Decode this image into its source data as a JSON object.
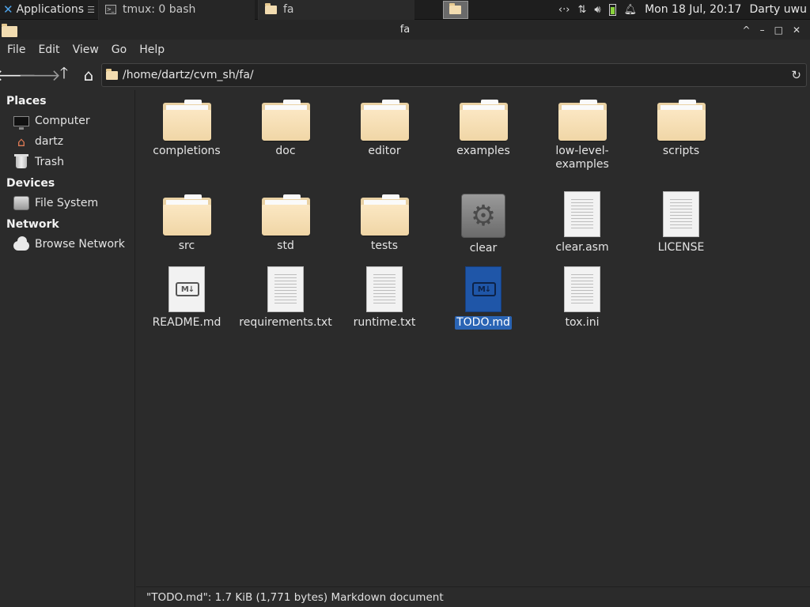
{
  "panel": {
    "apps_label": "Applications",
    "apps_suffix": "☰",
    "tasks": [
      {
        "label": "tmux: 0 bash"
      },
      {
        "label": "fa"
      }
    ],
    "datetime": "Mon 18 Jul, 20:17",
    "user": "Darty uwu"
  },
  "window": {
    "title": "fa",
    "controls": {
      "up": "^",
      "minimize": "–",
      "maximize": "□",
      "close": "✕"
    }
  },
  "menu": [
    "File",
    "Edit",
    "View",
    "Go",
    "Help"
  ],
  "location": {
    "path": "/home/dartz/cvm_sh/fa/"
  },
  "sidebar": {
    "sections": [
      {
        "title": "Places",
        "items": [
          {
            "label": "Computer",
            "icon": "monitor-icon"
          },
          {
            "label": "dartz",
            "icon": "home-icon"
          },
          {
            "label": "Trash",
            "icon": "trash-icon"
          }
        ]
      },
      {
        "title": "Devices",
        "items": [
          {
            "label": "File System",
            "icon": "drive-icon"
          }
        ]
      },
      {
        "title": "Network",
        "items": [
          {
            "label": "Browse Network",
            "icon": "network-icon"
          }
        ]
      }
    ]
  },
  "files": [
    {
      "name": "completions",
      "type": "folder"
    },
    {
      "name": "doc",
      "type": "folder"
    },
    {
      "name": "editor",
      "type": "folder"
    },
    {
      "name": "examples",
      "type": "folder"
    },
    {
      "name": "low-level-\nexamples",
      "type": "folder"
    },
    {
      "name": "scripts",
      "type": "folder"
    },
    {
      "name": "src",
      "type": "folder"
    },
    {
      "name": "std",
      "type": "folder"
    },
    {
      "name": "tests",
      "type": "folder"
    },
    {
      "name": "clear",
      "type": "executable"
    },
    {
      "name": "clear.asm",
      "type": "text"
    },
    {
      "name": "LICENSE",
      "type": "text"
    },
    {
      "name": "README.md",
      "type": "markdown"
    },
    {
      "name": "requirements.txt",
      "type": "text"
    },
    {
      "name": "runtime.txt",
      "type": "text"
    },
    {
      "name": "TODO.md",
      "type": "markdown",
      "selected": true
    },
    {
      "name": "tox.ini",
      "type": "text"
    }
  ],
  "status": "\"TODO.md\": 1.7 KiB (1,771 bytes) Markdown document",
  "colors": {
    "selection": "#2a64b4",
    "background": "#2b2b2b"
  }
}
